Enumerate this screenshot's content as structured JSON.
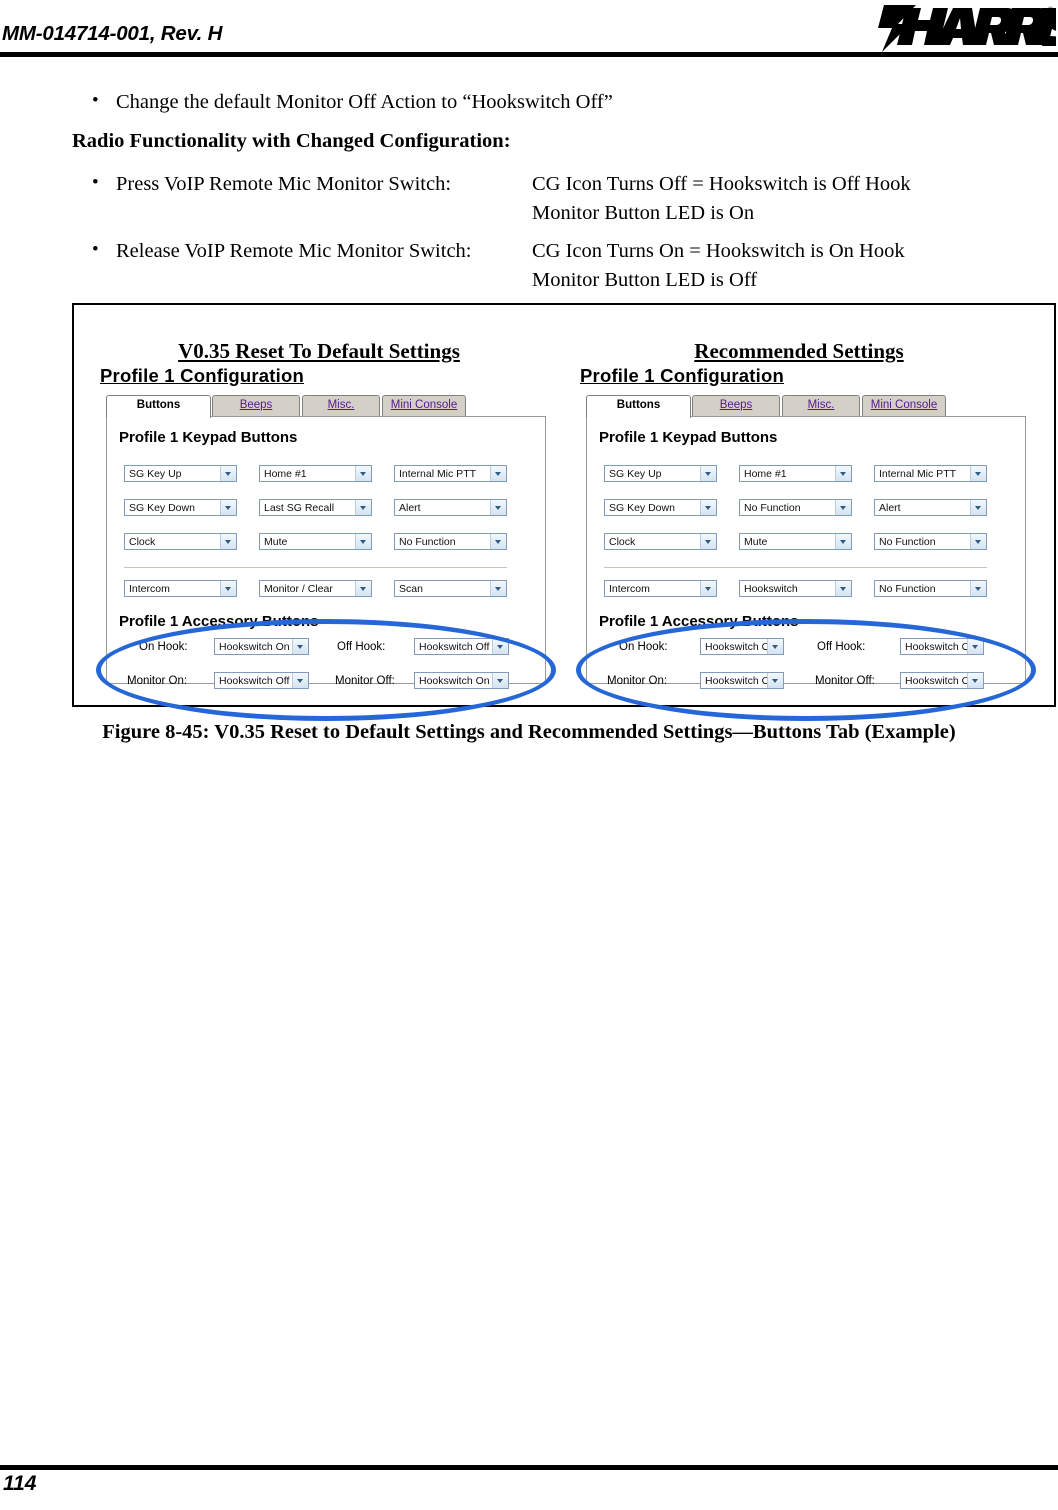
{
  "header": {
    "document_id": "MM-014714-001, Rev. H",
    "logo_text": "HARRIS",
    "logo_trademark": "®"
  },
  "body": {
    "bullet_change_default": "Change the default Monitor Off Action to “Hookswitch Off”",
    "section_heading": "Radio Functionality with Changed Configuration:",
    "functionality_rows": [
      {
        "action": "Press VoIP Remote Mic Monitor Switch:",
        "result_line1": "CG Icon Turns Off = Hookswitch is Off Hook",
        "result_line2": "Monitor Button LED is On"
      },
      {
        "action": "Release VoIP Remote Mic Monitor Switch:",
        "result_line1": "CG Icon Turns On = Hookswitch is On Hook",
        "result_line2": "Monitor Button LED is Off"
      }
    ]
  },
  "figure": {
    "caption": "Figure 8-45:  V0.35 Reset to Default Settings and Recommended Settings—Buttons Tab (Example)",
    "highlight_color": "#2566d8",
    "panels": [
      {
        "title": "V0.35 Reset To Default Settings",
        "subtitle": "Profile 1 Configuration",
        "tabs": [
          {
            "label": "Buttons",
            "active": true
          },
          {
            "label": "Beeps",
            "active": false
          },
          {
            "label": "Misc.",
            "active": false
          },
          {
            "label": "Mini Console",
            "active": false
          }
        ],
        "keypad_group_label": "Profile 1 Keypad Buttons",
        "keypad_rows": [
          [
            "SG Key Up",
            "Home #1",
            "Internal Mic PTT"
          ],
          [
            "SG Key Down",
            "Last SG Recall",
            "Alert"
          ],
          [
            "Clock",
            "Mute",
            "No Function"
          ],
          [
            "Intercom",
            "Monitor / Clear",
            "Scan"
          ]
        ],
        "accessory_group_label": "Profile 1 Accessory Buttons",
        "accessory_rows": [
          {
            "label_left": "On Hook:",
            "value_left": "Hookswitch On",
            "label_right": "Off Hook:",
            "value_right": "Hookswitch Off"
          },
          {
            "label_left": "Monitor On:",
            "value_left": "Hookswitch Off",
            "label_right": "Monitor Off:",
            "value_right": "Hookswitch On"
          }
        ]
      },
      {
        "title": "Recommended Settings",
        "subtitle": "Profile 1 Configuration",
        "tabs": [
          {
            "label": "Buttons",
            "active": true
          },
          {
            "label": "Beeps",
            "active": false
          },
          {
            "label": "Misc.",
            "active": false
          },
          {
            "label": "Mini Console",
            "active": false
          }
        ],
        "keypad_group_label": "Profile 1 Keypad Buttons",
        "keypad_rows": [
          [
            "SG Key Up",
            "Home #1",
            "Internal Mic PTT"
          ],
          [
            "SG Key Down",
            "No Function",
            "Alert"
          ],
          [
            "Clock",
            "Mute",
            "No Function"
          ],
          [
            "Intercom",
            "Hookswitch",
            "No Function"
          ]
        ],
        "accessory_group_label": "Profile 1 Accessory Buttons",
        "accessory_rows": [
          {
            "label_left": "On Hook:",
            "value_left": "Hookswitch Off",
            "label_right": "Off Hook:",
            "value_right": "Hookswitch On"
          },
          {
            "label_left": "Monitor On:",
            "value_left": "Hookswitch On",
            "label_right": "Monitor Off:",
            "value_right": "Hookswitch Off"
          }
        ]
      }
    ]
  },
  "footer": {
    "page_number": "114"
  }
}
